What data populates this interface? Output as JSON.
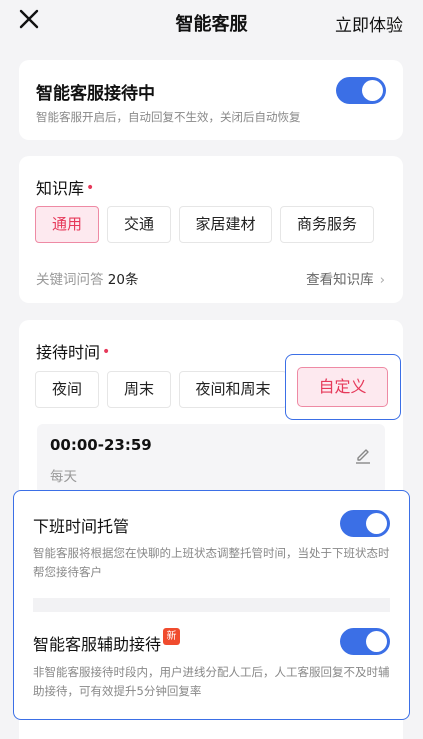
{
  "nav": {
    "close_icon": "close-icon",
    "title": "智能客服",
    "action": "立即体验"
  },
  "reception": {
    "title": "智能客服接待中",
    "subtitle": "智能客服开启后，自动回复不生效，关闭后自动恢复",
    "enabled": true
  },
  "knowledge": {
    "title": "知识库",
    "required_mark": "•",
    "chips": [
      "通用",
      "交通",
      "家居建材",
      "商务服务"
    ],
    "selected": "通用",
    "keyword_label": "关键词问答",
    "keyword_count": "20条",
    "view_link": "查看知识库",
    "view_chevron": "›"
  },
  "schedule": {
    "title": "接待时间",
    "required_mark": "•",
    "chips": [
      "夜间",
      "周末",
      "夜间和周末",
      "自定义"
    ],
    "selected": "自定义",
    "time_range": "00:00-23:59",
    "repeat": "每天"
  },
  "offhours": {
    "title": "下班时间托管",
    "desc": "智能客服将根据您在快聊的上班状态调整托管时间，当处于下班状态时帮您接待客户",
    "enabled": true
  },
  "assist": {
    "title": "智能客服辅助接待",
    "badge": "新",
    "desc": "非智能客服接待时段内，用户进线分配人工后，人工客服回复不及时辅助接待，可有效提升5分钟回复率",
    "enabled": true
  },
  "colors": {
    "accent": "#3b6fe6",
    "pink": "#e6395a",
    "pink_bg": "#fde9ef"
  }
}
